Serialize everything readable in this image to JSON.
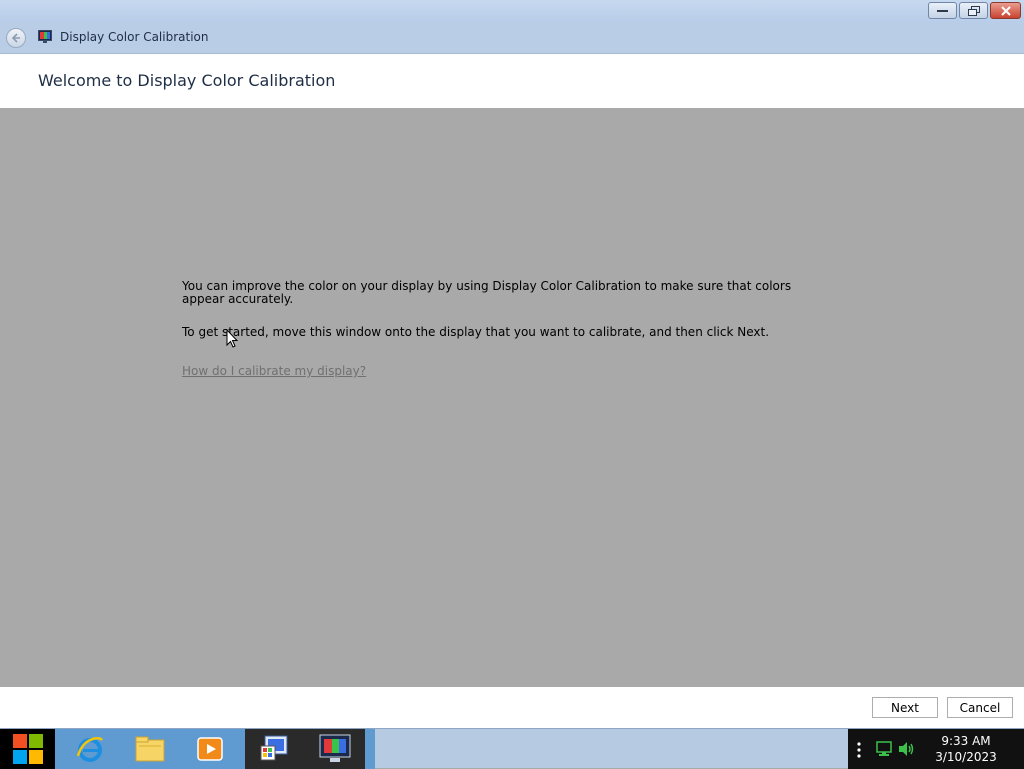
{
  "window": {
    "title": "Display Color Calibration",
    "caption_buttons": [
      "minimize",
      "restore",
      "close"
    ]
  },
  "header": {
    "heading": "Welcome to Display Color Calibration"
  },
  "content": {
    "paragraph1": "You can improve the color on your display by using Display Color Calibration to make sure that colors appear accurately.",
    "paragraph2": "To get started, move this window onto the display that you want to calibrate, and then click Next.",
    "help_link": "How do I calibrate my display?"
  },
  "footer": {
    "next_label": "Next",
    "cancel_label": "Cancel"
  },
  "taskbar": {
    "pinned": [
      "internet-explorer-icon",
      "file-explorer-icon",
      "media-player-icon",
      "control-panel-icon",
      "display-color-calibration-icon"
    ],
    "tray_icons": [
      "network-icon",
      "volume-icon"
    ],
    "time": "9:33 AM",
    "date": "3/10/2023"
  },
  "colors": {
    "content_bg": "#a9a9a9",
    "titlebar_bg": "#b9cde6",
    "taskbar_bg": "#b6cbe2"
  }
}
